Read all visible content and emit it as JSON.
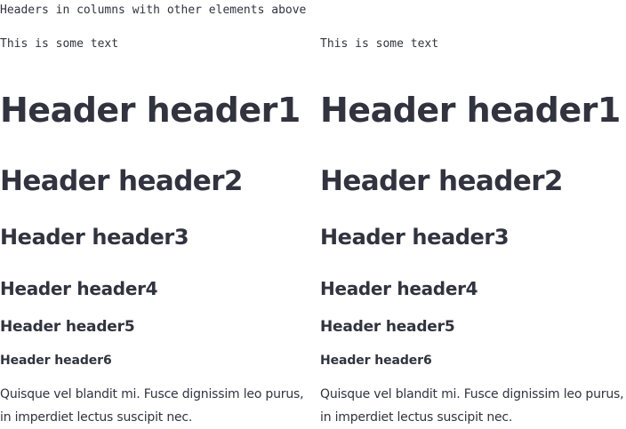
{
  "page": {
    "caption": "Headers in columns with other elements above"
  },
  "columns": [
    {
      "text": "This is some text",
      "headers": {
        "h1": "Header header1",
        "h2": "Header header2",
        "h3": "Header header3",
        "h4": "Header header4",
        "h5": "Header header5",
        "h6": "Header header6"
      },
      "paragraph": "Quisque vel blandit mi. Fusce dignissim leo purus, in imperdiet lectus suscipit nec."
    },
    {
      "text": "This is some text",
      "headers": {
        "h1": "Header header1",
        "h2": "Header header2",
        "h3": "Header header3",
        "h4": "Header header4",
        "h5": "Header header5",
        "h6": "Header header6"
      },
      "paragraph": "Quisque vel blandit mi. Fusce dignissim leo purus, in imperdiet lectus suscipit nec."
    }
  ],
  "colors": {
    "text": "#31333f",
    "background": "#ffffff"
  }
}
